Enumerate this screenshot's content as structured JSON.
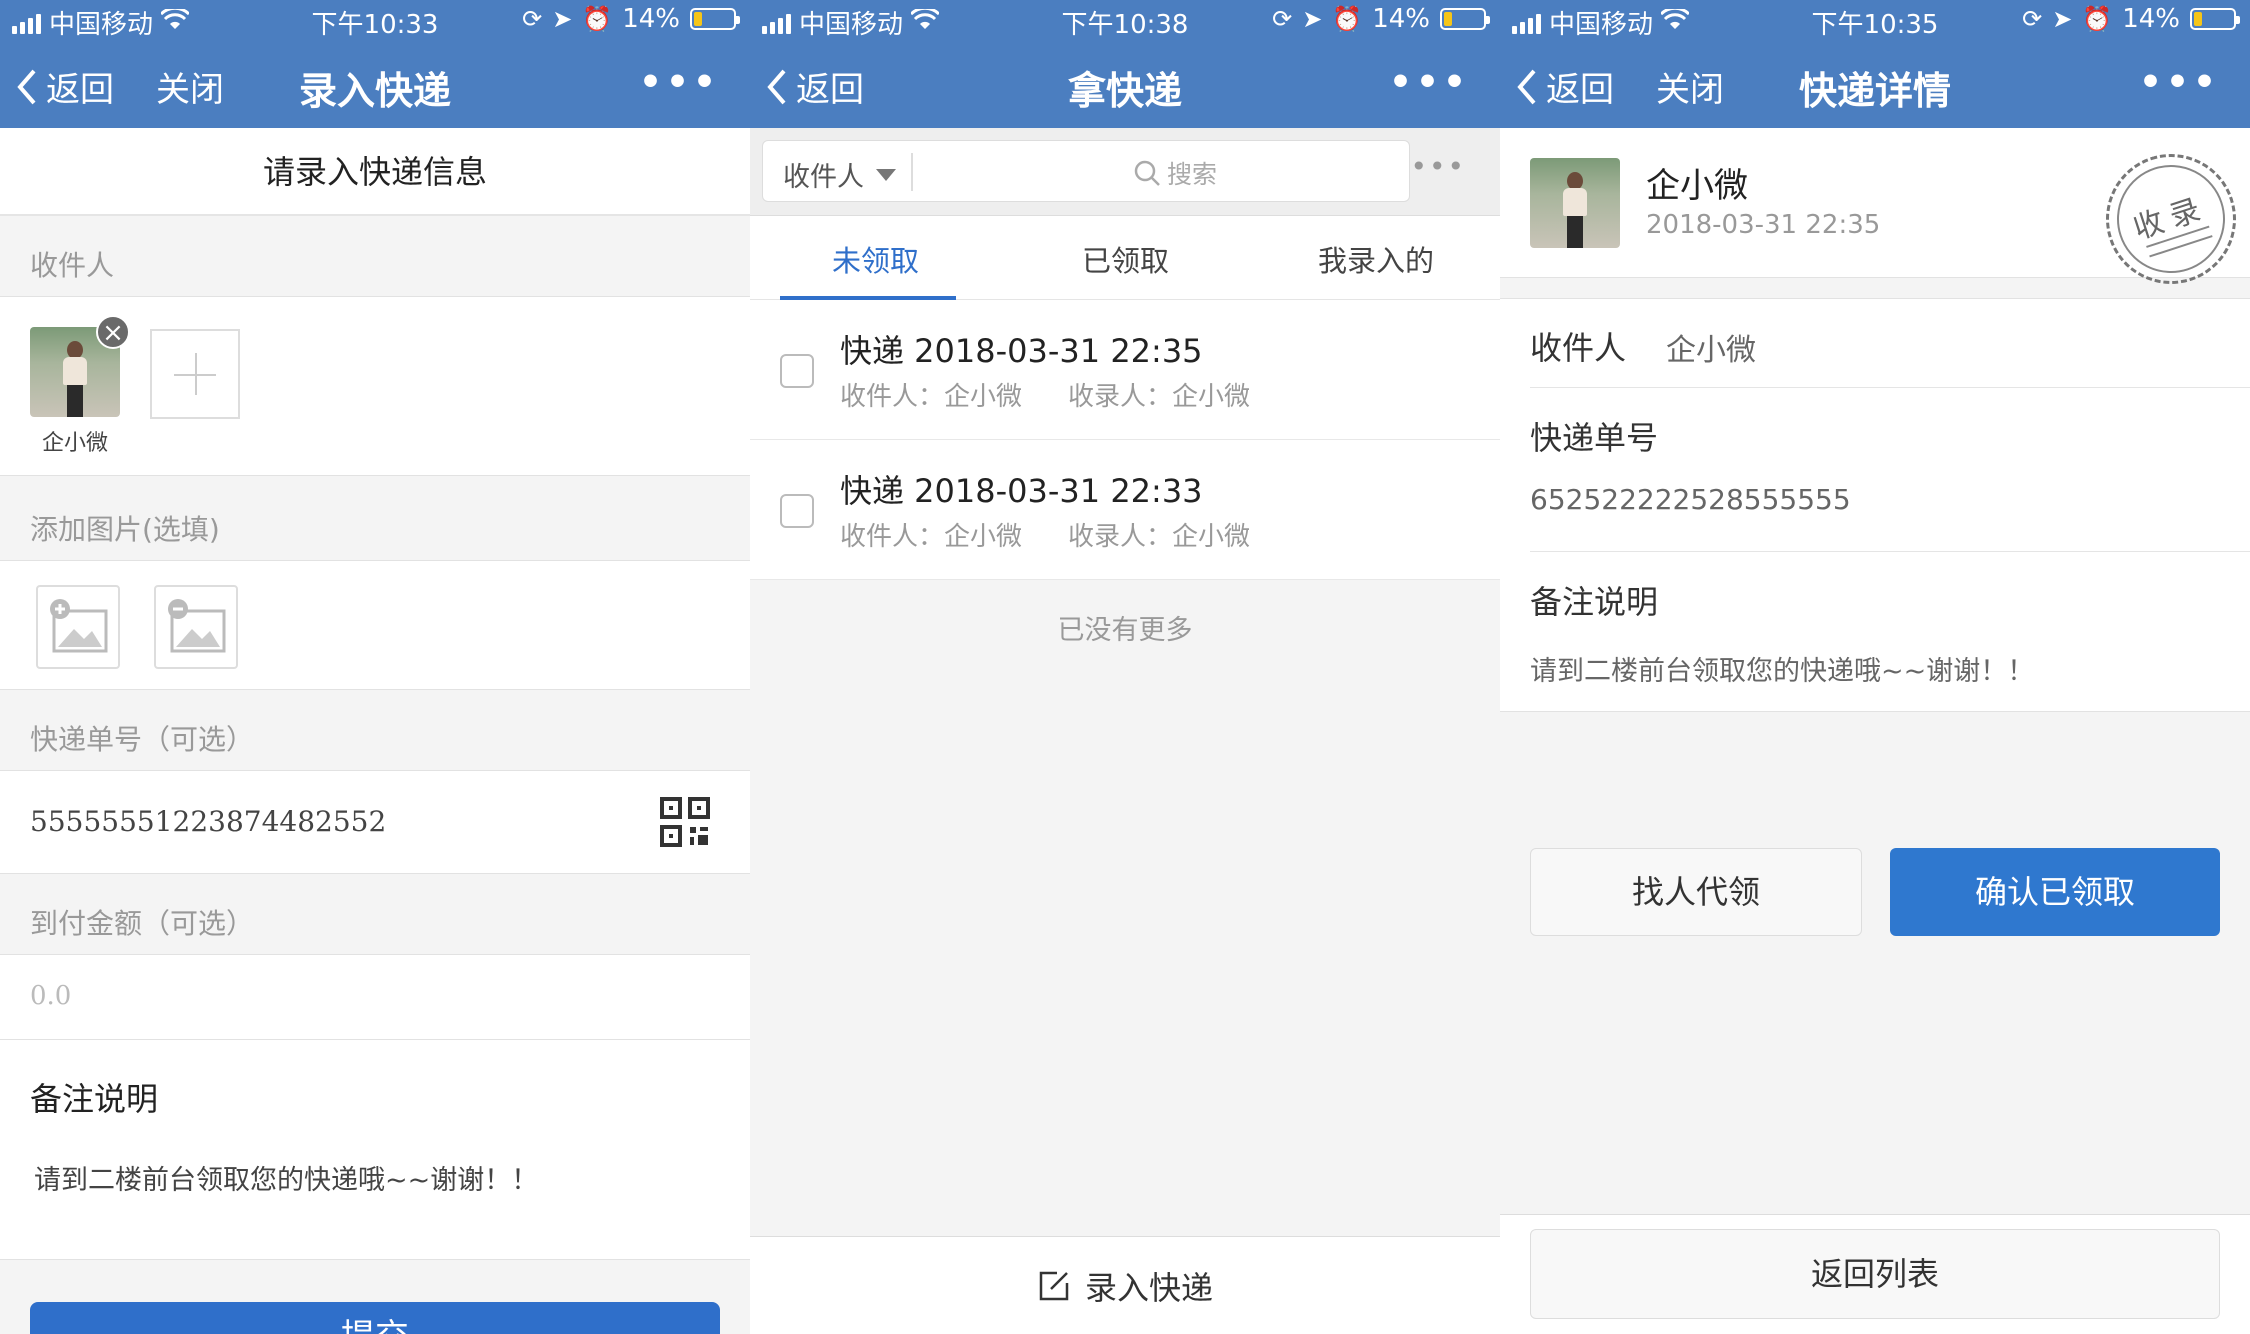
{
  "status_bars": [
    {
      "carrier": "中国移动",
      "time": "下午10:33",
      "battery": "14%"
    },
    {
      "carrier": "中国移动",
      "time": "下午10:38",
      "battery": "14%"
    },
    {
      "carrier": "中国移动",
      "time": "下午10:35",
      "battery": "14%"
    }
  ],
  "panel1": {
    "nav": {
      "back": "返回",
      "close": "关闭",
      "title": "录入快递",
      "more": "•••"
    },
    "header": "请录入快递信息",
    "recipient_label": "收件人",
    "recipient_name": "企小微",
    "add_images_label": "添加图片(选填)",
    "tracking_label": "快递单号（可选）",
    "tracking_value": "5555555122387448255​2",
    "cod_label": "到付金额（可选）",
    "cod_placeholder": "0.0",
    "remarks_label": "备注说明",
    "remarks_value": "请到二楼前台领取您的快递哦~~谢谢！！",
    "submit": "提交"
  },
  "panel2": {
    "nav": {
      "back": "返回",
      "title": "拿快递",
      "more": "•••"
    },
    "search": {
      "filter": "收件人",
      "placeholder": "搜索",
      "more": "•••"
    },
    "tabs": [
      "未领取",
      "已领取",
      "我录入的"
    ],
    "items": [
      {
        "title": "快递 2018-03-31 22:35",
        "recipient": "收件人：企小微",
        "recorder": "收录人：企小微"
      },
      {
        "title": "快递 2018-03-31 22:33",
        "recipient": "收件人：企小微",
        "recorder": "收录人：企小微"
      }
    ],
    "no_more": "已没有更多",
    "bottom_button": "录入快递"
  },
  "panel3": {
    "nav": {
      "back": "返回",
      "close": "关闭",
      "title": "快递详情",
      "more": "•••"
    },
    "name": "企小微",
    "datetime": "2018-03-31 22:35",
    "stamp": "收录",
    "recipient_label": "收件人",
    "recipient_value": "企小微",
    "tracking_label": "快递单号",
    "tracking_value": "652522222528555555",
    "remarks_label": "备注说明",
    "remarks_value": "请到二楼前台领取您的快递哦~~谢谢！！",
    "btn_proxy": "找人代领",
    "btn_confirm": "确认已领取",
    "btn_return": "返回列表"
  },
  "colors": {
    "nav_bg": "#4b7ec0",
    "primary": "#2f78cf",
    "active_tab": "#2f6fca",
    "battery_low": "#f5c518"
  },
  "icons": [
    "signal-icon",
    "wifi-icon",
    "lock-rotation-icon",
    "location-icon",
    "alarm-icon",
    "battery-icon",
    "chevron-left-icon",
    "more-icon",
    "remove-icon",
    "add-icon",
    "add-image-icon",
    "remove-image-icon",
    "qr-code-icon",
    "dropdown-icon",
    "search-icon",
    "checkbox-icon",
    "edit-icon",
    "stamp-icon"
  ]
}
